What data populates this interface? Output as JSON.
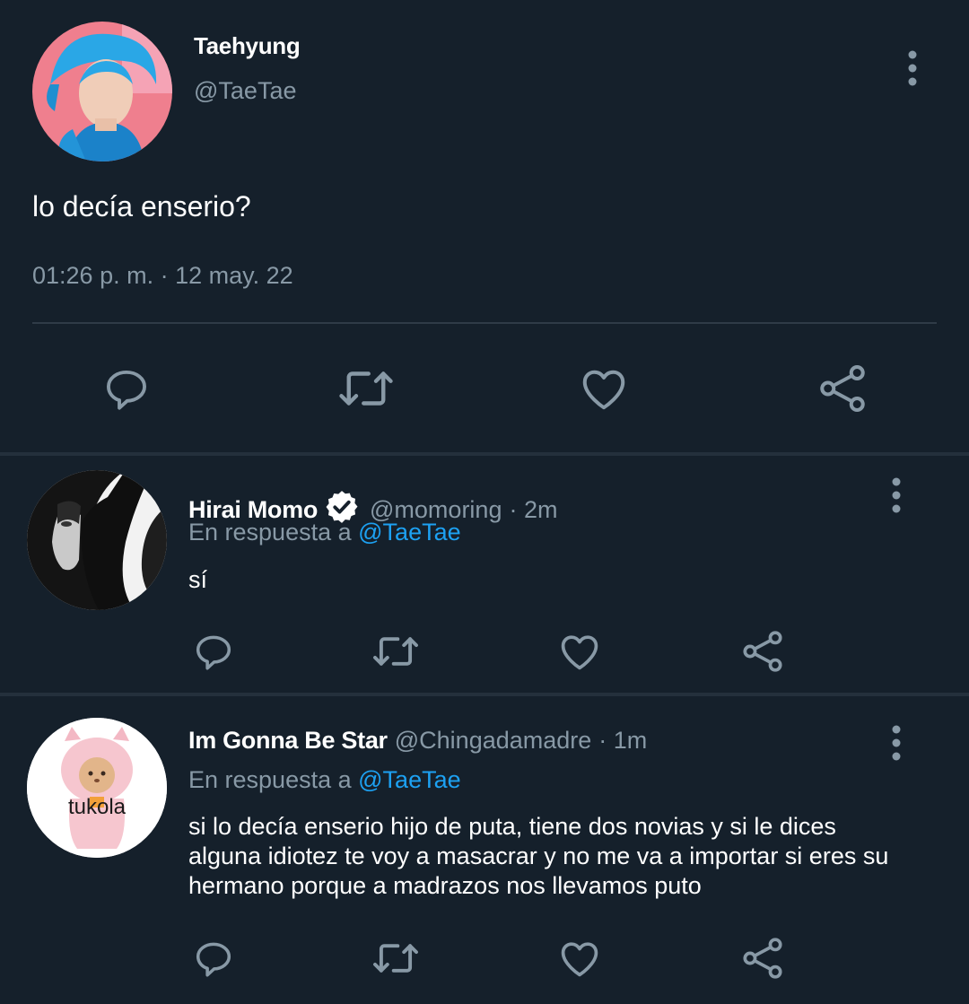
{
  "main_tweet": {
    "display_name": "Taehyung",
    "handle": "@TaeTae",
    "text": "lo decía enserio?",
    "timestamp": "01:26 p. m. · 12 may. 22",
    "actions": [
      "reply-icon",
      "retweet-icon",
      "like-icon",
      "share-icon"
    ]
  },
  "replies": [
    {
      "display_name": "Hirai Momo",
      "verified": true,
      "handle": "@momoring",
      "time": "· 2m",
      "replying_prefix": "En respuesta a",
      "replying_to": "@TaeTae",
      "text": "sí"
    },
    {
      "display_name": "Im Gonna Be Star",
      "verified": false,
      "handle": "@Chingadamadre",
      "time": "· 1m",
      "replying_prefix": "En respuesta a",
      "replying_to": "@TaeTae",
      "text": "si lo decía enserio hijo de puta, tiene dos novias y si le dices alguna idiotez te voy a masacrar y no me va a importar si eres su hermano porque a madrazos nos llevamos puto",
      "avatar_caption": "tukola"
    }
  ],
  "colors": {
    "background": "#15202b",
    "text": "#ffffff",
    "muted": "#8899a6",
    "link": "#1da1f2",
    "divider": "#2f3b47"
  }
}
